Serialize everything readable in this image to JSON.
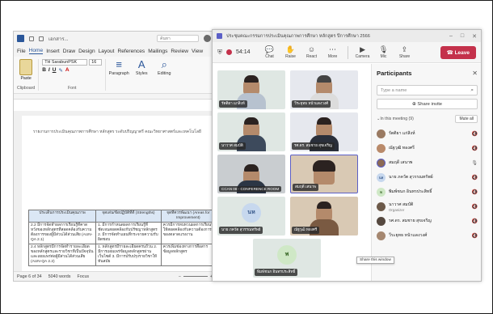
{
  "word": {
    "title": "เอกสาร...",
    "search_placeholder": "ค้นหา",
    "tabs": [
      "File",
      "Home",
      "Insert",
      "Draw",
      "Design",
      "Layout",
      "References",
      "Mailings",
      "Review",
      "View"
    ],
    "font_name": "TH SarabunPSK",
    "font_size": "16",
    "ribbon": {
      "paste": "Paste",
      "clipboard": "Clipboard",
      "font": "Font",
      "paragraph": "Paragraph",
      "styles": "Styles",
      "editing": "Editing",
      "styles_group": "Styles"
    },
    "doc_header_line": "รายงานการประเมินคุณภาพการศึกษา หลักสูตร ระดับปริญญาตรี คณะวิทยาศาสตร์และเทคโนโลยี",
    "table": {
      "headers": [
        "ประเด็นการประเมินคุณภาพ",
        "จุดเด่น/ข้อปฏิบัติที่ดี (Strengths)",
        "จุดที่ควรพัฒนา (Areas for Improvement)"
      ],
      "rows": [
        [
          "2.2 มีการจัดทำผลการเรียนรู้ที่คาดหวังของหลักสูตรที่สอดคล้องกับความต้องการของผู้มีส่วนได้ส่วนเสีย (AUN-QA 2.1)",
          "1. มีการกำหนดผลการเรียนรู้ที่ชัดเจนสอดคล้องกับปรัชญาหลักสูตร 2. มีการจัดทำแผนที่กระจายความรับผิดชอบ",
          "ควรมีการทบทวนผลการเรียนรู้ให้สอดคล้องกับความต้องการของตลาดแรงงาน"
        ],
        [
          "2.4 หลักสูตรมีการจัดทำรายละเอียดของหลักสูตรและรายวิชาที่เป็นปัจจุบันและเผยแพร่ต่อผู้มีส่วนได้ส่วนเสีย (AUN-QA 2.2)",
          "1. หลักสูตรมีรายละเอียดครบถ้วน 2. มีการเผยแพร่ข้อมูลหลักสูตรผ่านเว็บไซต์ 3. มีการปรับปรุงรายวิชาให้ทันสมัย",
          "ควรเพิ่มช่องทางการสื่อสารข้อมูลหลักสูตร"
        ]
      ]
    },
    "status": {
      "page": "Page 6 of 34",
      "words": "5040 words",
      "focus": "Focus"
    }
  },
  "teams": {
    "window_title": "ประชุมคณะกรรมการประเมินคุณภาพการศึกษา หลักสูตร ปีการศึกษา 2566",
    "timer": "54:14",
    "toolbar": [
      "Chat",
      "Raise",
      "React",
      "More",
      "Camera",
      "Mic",
      "Share"
    ],
    "leave_label": "Leave",
    "tiles": [
      {
        "name": "รัตติยา แก่สิงห์"
      },
      {
        "name": "วีระยุทธ หน้าแดงวงศ์"
      },
      {
        "name": "นาวาศ สมบัติ"
      },
      {
        "name": "รศ.ดร. สมชาย สุขเจริญ"
      },
      {
        "name": "CCAN 08 - CONFERENCE ROOM"
      },
      {
        "name": "สมฤดี เสนาพ"
      },
      {
        "name": "นาย ภควัต สุวรรณทรัพย์",
        "initials": "นห"
      },
      {
        "name": "ณัฐวุฒิ ทองศรี"
      },
      {
        "name": "พิมพ์ชนก อินทรประสิทธิ์",
        "initials": "พ"
      }
    ],
    "panel": {
      "title": "Participants",
      "search_placeholder": "Type a name",
      "share_invite": "Share invite",
      "in_meeting": "In this meeting (9)",
      "mute_all": "Mute all",
      "participants": [
        {
          "name": "รัตติยา แก่สิงห์",
          "sub": ""
        },
        {
          "name": "ณัฐวุฒิ ทองศรี",
          "sub": ""
        },
        {
          "name": "สมฤดี เสนาพ",
          "sub": ""
        },
        {
          "name": "นาย ภควัต สุวรรณทรัพย์",
          "sub": "",
          "initials": "นห"
        },
        {
          "name": "พิมพ์ชนก อินทรประสิทธิ์",
          "sub": "",
          "initials": "พ"
        },
        {
          "name": "นาวาศ สมบัติ",
          "sub": "Organizer"
        },
        {
          "name": "รศ.ดร. สมชาย สุขเจริญ",
          "sub": ""
        },
        {
          "name": "วีระยุทธ หน้าแดงวงศ์",
          "sub": ""
        }
      ],
      "tooltip": "Share this window"
    }
  }
}
